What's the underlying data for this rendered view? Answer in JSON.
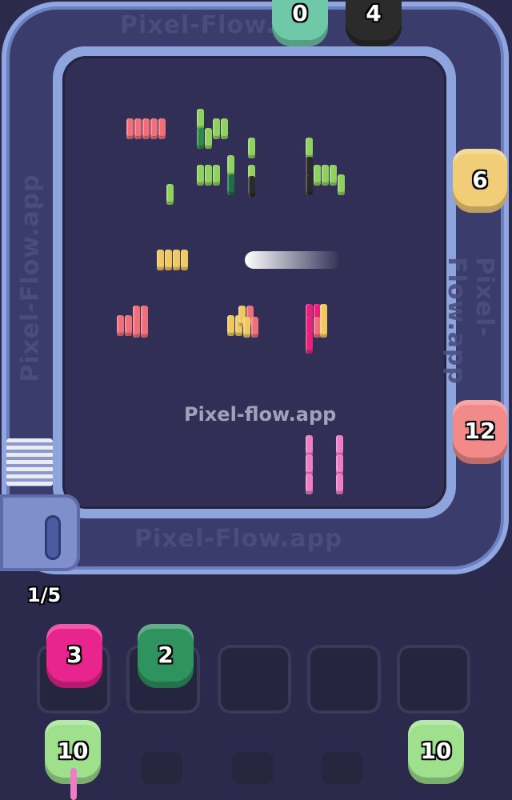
{
  "watermark": "Pixel-flow.app",
  "track_texts": [
    "Pixel-Flow.app",
    "Pixel-Flow.app",
    "Pixel-Flow.app",
    "Pixel-Flow.app"
  ],
  "progress": "1/5",
  "colors": {
    "pink": "#e8207a",
    "salmon": "#ef6f7a",
    "yellow": "#f0c860",
    "lightgreen": "#8fd060",
    "darkgreen": "#2f8a4a",
    "black": "#2a2a2a",
    "teal": "#5fbfa0",
    "lightpink": "#ee7cc6",
    "peach": "#f2c46b",
    "coral": "#f27d7a"
  },
  "track_shooters": [
    {
      "name": "teal",
      "count": "0",
      "color": "#6fc9a8"
    },
    {
      "name": "black",
      "count": "4",
      "color": "#2b2b2b"
    },
    {
      "name": "peach",
      "count": "6",
      "color": "#f2cd78"
    },
    {
      "name": "coral",
      "count": "12",
      "color": "#f28a8a"
    }
  ],
  "queue_shooters": [
    {
      "name": "magenta",
      "count": "3",
      "color": "#e8258f"
    },
    {
      "name": "green",
      "count": "2",
      "color": "#2f9360"
    }
  ],
  "waiting_shooters": [
    {
      "name": "lightgreen-left",
      "count": "10",
      "color": "#9ee08c"
    },
    {
      "name": "lightgreen-right",
      "count": "10",
      "color": "#9ee08c"
    }
  ]
}
